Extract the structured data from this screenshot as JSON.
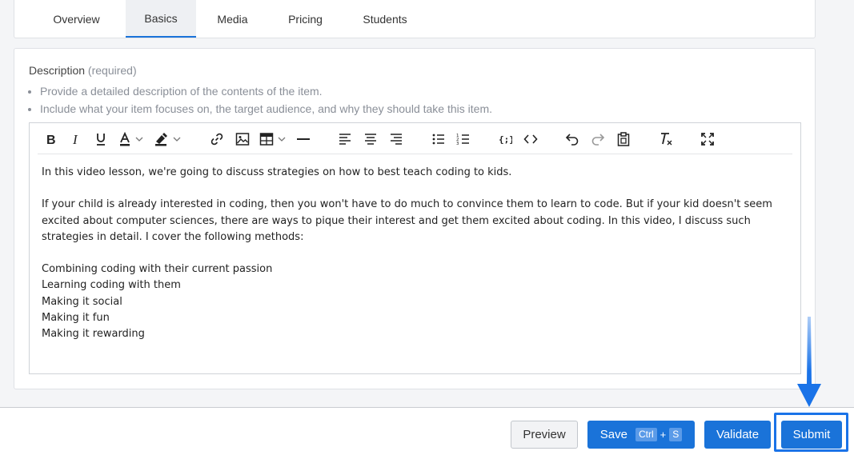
{
  "tabs": [
    {
      "label": "Overview"
    },
    {
      "label": "Basics",
      "active": true
    },
    {
      "label": "Media"
    },
    {
      "label": "Pricing"
    },
    {
      "label": "Students"
    }
  ],
  "description": {
    "label": "Description",
    "required_text": "(required)",
    "hints": [
      "Provide a detailed description of the contents of the item.",
      "Include what your item focuses on, the target audience, and why they should take this item."
    ]
  },
  "toolbar_icons": [
    "bold-icon",
    "italic-icon",
    "underline-icon",
    "text-color-icon",
    "highlight-icon",
    "link-icon",
    "image-icon",
    "table-icon",
    "horizontal-rule-icon",
    "align-left-icon",
    "align-center-icon",
    "align-right-icon",
    "bullet-list-icon",
    "numbered-list-icon",
    "code-block-icon",
    "code-inline-icon",
    "undo-icon",
    "redo-icon",
    "paste-icon",
    "clear-format-icon",
    "fullscreen-icon"
  ],
  "editor": {
    "paragraph1": "In this video lesson, we're going to discuss strategies on how to best teach coding to kids.",
    "paragraph2": "If your child is already interested in coding, then you won't have to do much to convince them to learn to code. But if your kid doesn't seem excited about computer sciences, there are ways to pique their interest and get them excited about coding. In this video, I discuss such strategies in detail. I cover the following methods:",
    "methods": [
      "Combining coding with their current passion",
      "Learning coding with them",
      "Making it social",
      "Making it fun",
      "Making it rewarding"
    ]
  },
  "footer": {
    "preview_label": "Preview",
    "save_label": "Save",
    "save_kbd_ctrl": "Ctrl",
    "save_kbd_plus": "+",
    "save_kbd_key": "S",
    "validate_label": "Validate",
    "submit_label": "Submit"
  },
  "colors": {
    "accent": "#1a73d9",
    "annotation": "#1a73e8"
  }
}
